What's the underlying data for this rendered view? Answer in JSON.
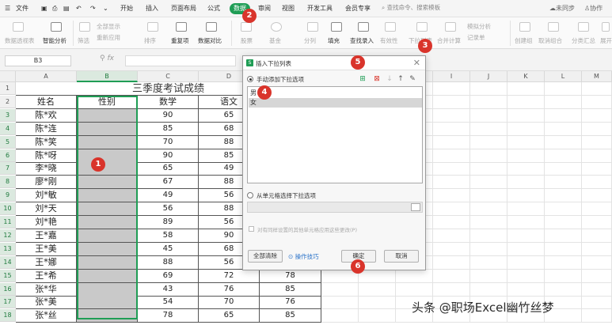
{
  "menubar": {
    "file": "文件",
    "tabs": [
      "开始",
      "插入",
      "页面布局",
      "公式",
      "数据",
      "审阅",
      "视图",
      "开发工具",
      "会员专享"
    ],
    "active_tab": "数据",
    "search_placeholder": "查找命令、搜索模板",
    "sync": "未同步",
    "collab": "协作"
  },
  "ribbon": {
    "pivot": "数据透视表",
    "smart": "智能分析",
    "filter": "筛选",
    "show_all": "全部显示",
    "reapply": "重新应用",
    "sort": "排序",
    "duplicates": "重复项",
    "compare": "数据对比",
    "stock": "股票",
    "fund": "基金",
    "split": "分列",
    "fill": "填充",
    "lookup": "查找录入",
    "validity": "有效性",
    "dropdown": "下拉列表",
    "consolidate": "合并计算",
    "simulate": "模拟分析",
    "record": "记录单",
    "group": "创建组",
    "ungroup": "取消组合",
    "subtotal": "分类汇总",
    "expand": "展开"
  },
  "formula_bar": {
    "cell_ref": "B3",
    "fx": "fx"
  },
  "sheet": {
    "columns": [
      "A",
      "B",
      "C",
      "D",
      "E",
      "F",
      "G",
      "H",
      "I",
      "J",
      "K",
      "L",
      "M"
    ],
    "title": "三季度考试成绩",
    "headers": [
      "姓名",
      "性别",
      "数学",
      "语文",
      "英语"
    ],
    "rows": [
      [
        "陈*欢",
        "",
        "90",
        "65",
        ""
      ],
      [
        "陈*连",
        "",
        "85",
        "68",
        ""
      ],
      [
        "陈*笑",
        "",
        "70",
        "88",
        ""
      ],
      [
        "陈*呀",
        "",
        "90",
        "85",
        ""
      ],
      [
        "李*晓",
        "",
        "65",
        "49",
        ""
      ],
      [
        "廖*刚",
        "",
        "67",
        "88",
        ""
      ],
      [
        "刘*敏",
        "",
        "49",
        "56",
        ""
      ],
      [
        "刘*天",
        "",
        "56",
        "88",
        ""
      ],
      [
        "刘*艳",
        "",
        "89",
        "56",
        ""
      ],
      [
        "王*嘉",
        "",
        "58",
        "90",
        ""
      ],
      [
        "王*美",
        "",
        "45",
        "68",
        ""
      ],
      [
        "王*娜",
        "",
        "88",
        "56",
        ""
      ],
      [
        "王*希",
        "",
        "69",
        "72",
        "78"
      ],
      [
        "张*华",
        "",
        "43",
        "76",
        "85"
      ],
      [
        "张*美",
        "",
        "54",
        "70",
        "76"
      ],
      [
        "张*丝",
        "",
        "78",
        "65",
        "85"
      ]
    ]
  },
  "dialog": {
    "title": "插入下拉列表",
    "manual_option": "手动添加下拉选项",
    "items": [
      "男",
      "女"
    ],
    "from_cells_option": "从单元格选择下拉选项",
    "apply_others": "对有同样设置的其他单元格应用这些更改(P)",
    "clear_all": "全部清除",
    "tips": "操作技巧",
    "ok": "确定",
    "cancel": "取消"
  },
  "annotations": [
    "1",
    "2",
    "3",
    "4",
    "5",
    "6"
  ],
  "watermark": "头条 @职场Excel幽竹丝梦",
  "colors": {
    "accent": "#1f9d55",
    "badge": "#d9342b"
  }
}
